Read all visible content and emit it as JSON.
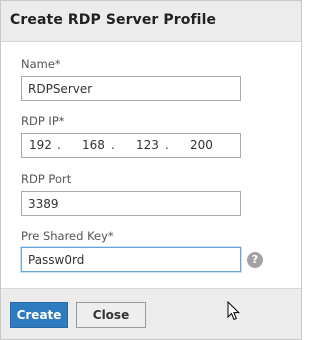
{
  "dialog": {
    "title": "Create RDP Server Profile"
  },
  "form": {
    "name": {
      "label": "Name*",
      "value": "RDPServer"
    },
    "rdp_ip": {
      "label": "RDP IP*",
      "octets": [
        "192",
        "168",
        "123",
        "200"
      ],
      "separator": "."
    },
    "rdp_port": {
      "label": "RDP Port",
      "value": "3389"
    },
    "pre_shared_key": {
      "label": "Pre Shared Key*",
      "value": "Passw0rd"
    },
    "help_icon": "?"
  },
  "footer": {
    "create_label": "Create",
    "close_label": "Close"
  },
  "colors": {
    "primary_button": "#2f7bbf",
    "focus_border": "#6aa2d8"
  }
}
